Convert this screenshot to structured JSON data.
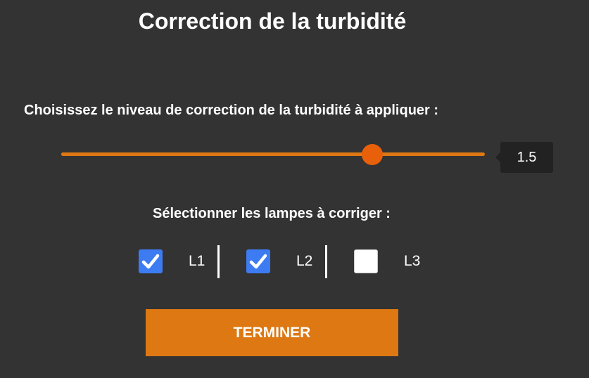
{
  "page": {
    "title": "Correction de la turbidité"
  },
  "turbidity": {
    "label": "Choisissez le niveau de correction de la turbidité à appliquer :",
    "value": "1.5",
    "level_fraction": 0.735,
    "track_color": "#dd7813",
    "thumb_color": "#e8600a"
  },
  "lamps": {
    "label": "Sélectionner les lampes à corriger :",
    "items": [
      {
        "label": "L1",
        "checked": true
      },
      {
        "label": "L2",
        "checked": true
      },
      {
        "label": "L3",
        "checked": false
      }
    ],
    "checkbox_color": "#3d7bf2"
  },
  "actions": {
    "finish_label": "TERMINER",
    "finish_color": "#dd7813"
  },
  "icons": {
    "checkbox_checked": "checkmark-icon"
  }
}
